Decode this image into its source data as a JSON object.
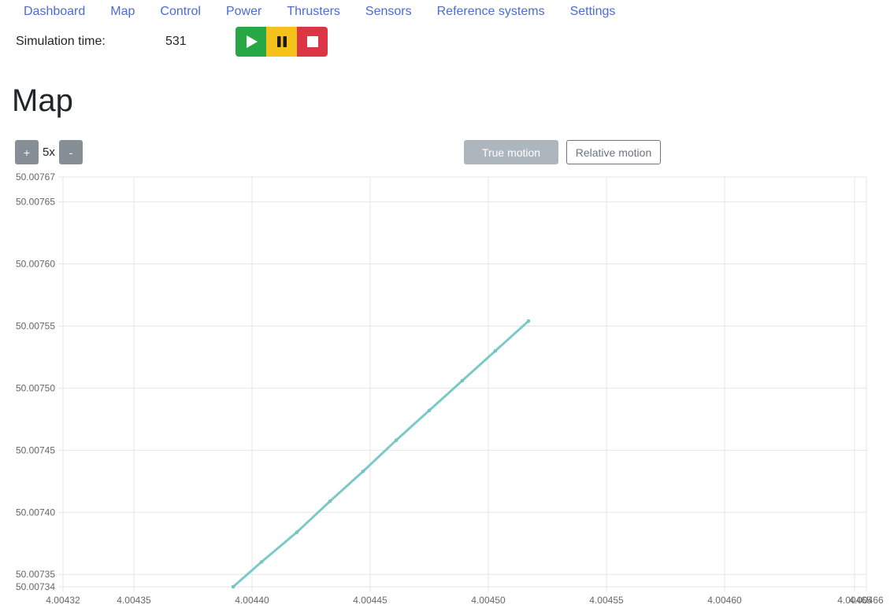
{
  "nav": {
    "items": [
      {
        "label": "Dashboard",
        "name": "nav-dashboard"
      },
      {
        "label": "Map",
        "name": "nav-map"
      },
      {
        "label": "Control",
        "name": "nav-control"
      },
      {
        "label": "Power",
        "name": "nav-power"
      },
      {
        "label": "Thrusters",
        "name": "nav-thrusters"
      },
      {
        "label": "Sensors",
        "name": "nav-sensors"
      },
      {
        "label": "Reference systems",
        "name": "nav-reference-systems"
      },
      {
        "label": "Settings",
        "name": "nav-settings"
      }
    ]
  },
  "simulation": {
    "label": "Simulation time:",
    "value": "531",
    "controls": [
      {
        "name": "play-button",
        "icon": "play-icon",
        "color": "#28a745"
      },
      {
        "name": "pause-button",
        "icon": "pause-icon",
        "color": "#f5c21b"
      },
      {
        "name": "stop-button",
        "icon": "stop-icon",
        "color": "#dc3545"
      }
    ]
  },
  "page": {
    "title": "Map"
  },
  "zoom": {
    "plus_label": "+",
    "value": "5x",
    "minus_label": "-"
  },
  "motion": {
    "true_label": "True motion",
    "relative_label": "Relative motion",
    "active": "true"
  },
  "chart_data": {
    "type": "line",
    "series": [
      {
        "color": "#7ccac6",
        "points": [
          [
            4.004392,
            50.00734
          ],
          [
            4.004404,
            50.00736
          ],
          [
            4.004419,
            50.007384
          ],
          [
            4.004433,
            50.007409
          ],
          [
            4.004447,
            50.007433
          ],
          [
            4.004461,
            50.007458
          ],
          [
            4.004475,
            50.007482
          ],
          [
            4.004489,
            50.007506
          ],
          [
            4.004503,
            50.00753
          ],
          [
            4.004517,
            50.007554
          ]
        ]
      }
    ],
    "xlim": [
      4.00432,
      4.00466
    ],
    "ylim": [
      50.00734,
      50.00767
    ],
    "x_ticks": [
      {
        "value": 4.00432,
        "label": "4.00432"
      },
      {
        "value": 4.00435,
        "label": "4.00435"
      },
      {
        "value": 4.0044,
        "label": "4.00440"
      },
      {
        "value": 4.00445,
        "label": "4.00445"
      },
      {
        "value": 4.0045,
        "label": "4.00450"
      },
      {
        "value": 4.00455,
        "label": "4.00455"
      },
      {
        "value": 4.0046,
        "label": "4.00460"
      },
      {
        "value": 4.004655,
        "label": "4.00465"
      },
      {
        "value": 4.00466,
        "label": "4.00466"
      }
    ],
    "y_ticks": [
      {
        "value": 50.00734,
        "label": "50.00734"
      },
      {
        "value": 50.00735,
        "label": "50.00735"
      },
      {
        "value": 50.0074,
        "label": "50.00740"
      },
      {
        "value": 50.00745,
        "label": "50.00745"
      },
      {
        "value": 50.0075,
        "label": "50.00750"
      },
      {
        "value": 50.00755,
        "label": "50.00755"
      },
      {
        "value": 50.0076,
        "label": "50.00760"
      },
      {
        "value": 50.00765,
        "label": "50.00765"
      },
      {
        "value": 50.00767,
        "label": "50.00767"
      }
    ],
    "grid": true
  }
}
